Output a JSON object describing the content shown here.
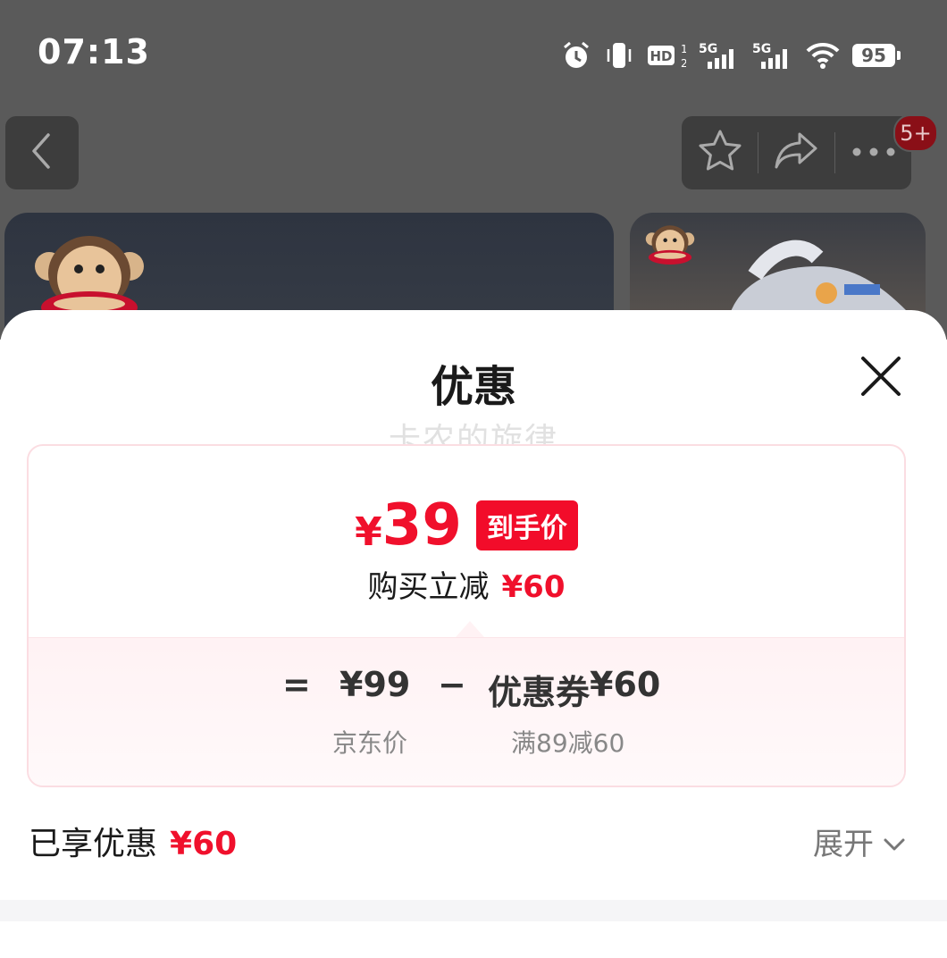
{
  "status_bar": {
    "time": "07:13",
    "battery": "95",
    "network": [
      "5G",
      "5G"
    ],
    "icons": [
      "alarm-icon",
      "vibrate-icon",
      "hd-icon",
      "signal-icon",
      "signal-icon",
      "wifi-icon",
      "battery-icon"
    ]
  },
  "nav": {
    "back_icon": "chevron-left-icon",
    "favorite_icon": "star-icon",
    "share_icon": "share-icon",
    "more_icon": "more-icon",
    "badge": "5+"
  },
  "sheet": {
    "title": "优惠",
    "watermark": "卡农的旋律",
    "price": {
      "currency": "¥",
      "value": "39",
      "tag": "到手价",
      "reduce_label": "购买立减",
      "reduce_amount": "¥60"
    },
    "breakdown": {
      "equals": "=",
      "base_price": "¥99",
      "minus": "−",
      "coupon_label": "优惠券",
      "coupon_amount": "¥60",
      "base_caption": "京东价",
      "coupon_caption": "满89减60"
    },
    "enjoyed_label": "已享优惠",
    "enjoyed_amount": "¥60",
    "expand_label": "展开"
  },
  "colors": {
    "accent_red": "#f0102c",
    "tag_red": "#f20c2a",
    "overlay": "#5a5a5a"
  }
}
